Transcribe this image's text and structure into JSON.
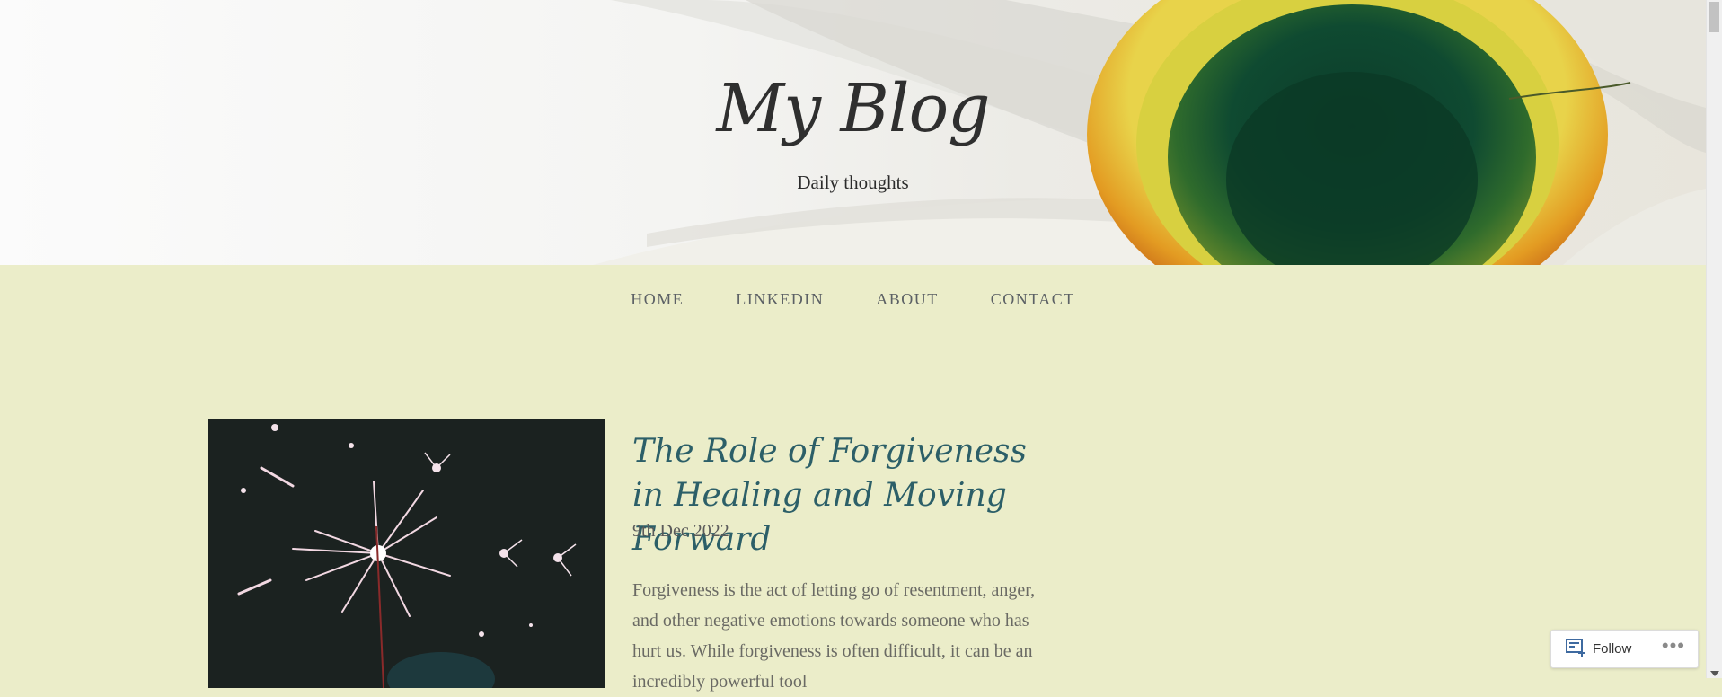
{
  "header": {
    "site_title": "My Blog",
    "tagline": "Daily thoughts"
  },
  "nav": {
    "items": [
      {
        "label": "HOME"
      },
      {
        "label": "LINKEDIN"
      },
      {
        "label": "ABOUT"
      },
      {
        "label": "CONTACT"
      }
    ]
  },
  "post": {
    "title": "The Role of Forgiveness in Healing and Moving Forward",
    "date": "9th Dec 2022",
    "excerpt": "Forgiveness is the act of letting go of resentment, anger, and other negative emotions towards someone who has hurt us. While forgiveness is often difficult, it can be an incredibly powerful tool"
  },
  "follow_widget": {
    "label": "Follow",
    "more": "•••"
  },
  "colors": {
    "background": "#ebedc9",
    "post_title": "#2c5f68",
    "nav_text": "#5c6165"
  },
  "icons": {
    "follow": "reader-follow-icon",
    "more": "ellipsis-icon"
  }
}
